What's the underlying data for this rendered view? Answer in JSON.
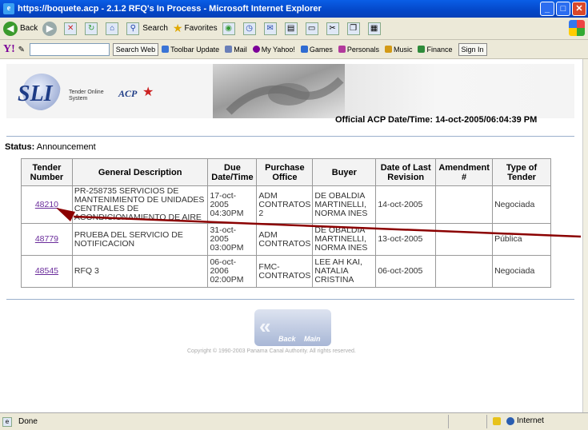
{
  "window": {
    "title": "https://boquete.acp - 2.1.2 RFQ's In Process - Microsoft Internet Explorer",
    "controls": [
      "_",
      "□",
      "✕"
    ]
  },
  "std_toolbar": {
    "back_label": "Back",
    "search_label": "Search",
    "favorites_label": "Favorites"
  },
  "yahoo_toolbar": {
    "logo": "Y!",
    "search_button": "Search Web",
    "items": [
      "Toolbar Update",
      "Mail",
      "My Yahoo!",
      "Games",
      "Personals",
      "Music",
      "Finance"
    ],
    "sign_in": "Sign In"
  },
  "banner": {
    "logo": "SLI",
    "system_name": "Tender Online System",
    "acp_logo": "ACP"
  },
  "official_datetime": "Official ACP Date/Time: 14-oct-2005/06:04:39 PM",
  "status": {
    "label": "Status:",
    "value": "Announcement"
  },
  "table": {
    "headers": [
      "Tender Number",
      "General Description",
      "Due Date/Time",
      "Purchase Office",
      "Buyer",
      "Date of Last Revision",
      "Amendment #",
      "Type of Tender"
    ],
    "rows": [
      {
        "tender_number": "48210",
        "description": "PR-258735 SERVICIOS DE MANTENIMIENTO DE UNIDADES CENTRALES DE ACONDICIONAMIENTO DE AIRE",
        "due": "17-oct-2005 04:30PM",
        "office": "ADM CONTRATOS 2",
        "buyer": "DE OBALDIA MARTINELLI, NORMA INES",
        "last_revision": "14-oct-2005",
        "amendment": "",
        "type": "Negociada"
      },
      {
        "tender_number": "48779",
        "description": "PRUEBA DEL SERVICIO DE NOTIFICACION",
        "due": "31-oct-2005 03:00PM",
        "office": "ADM CONTRATOS",
        "buyer": "DE OBALDIA MARTINELLI, NORMA INES",
        "last_revision": "13-oct-2005",
        "amendment": "",
        "type": "Pública"
      },
      {
        "tender_number": "48545",
        "description": "RFQ 3",
        "due": "06-oct-2006 02:00PM",
        "office": "FMC-CONTRATOS",
        "buyer": "LEE AH KAI, NATALIA CRISTINA",
        "last_revision": "06-oct-2005",
        "amendment": "",
        "type": "Negociada"
      }
    ]
  },
  "nav": {
    "back": "Back",
    "main": "Main"
  },
  "copyright": "Copyright © 1990-2003 Panama Canal Authority. All rights reserved.",
  "statusbar": {
    "left": "Done",
    "zone": "Internet"
  },
  "colors": {
    "titlebar": "#0447c8",
    "link_visited": "#6a2c9b",
    "annotation_arrow": "#8b0000"
  }
}
